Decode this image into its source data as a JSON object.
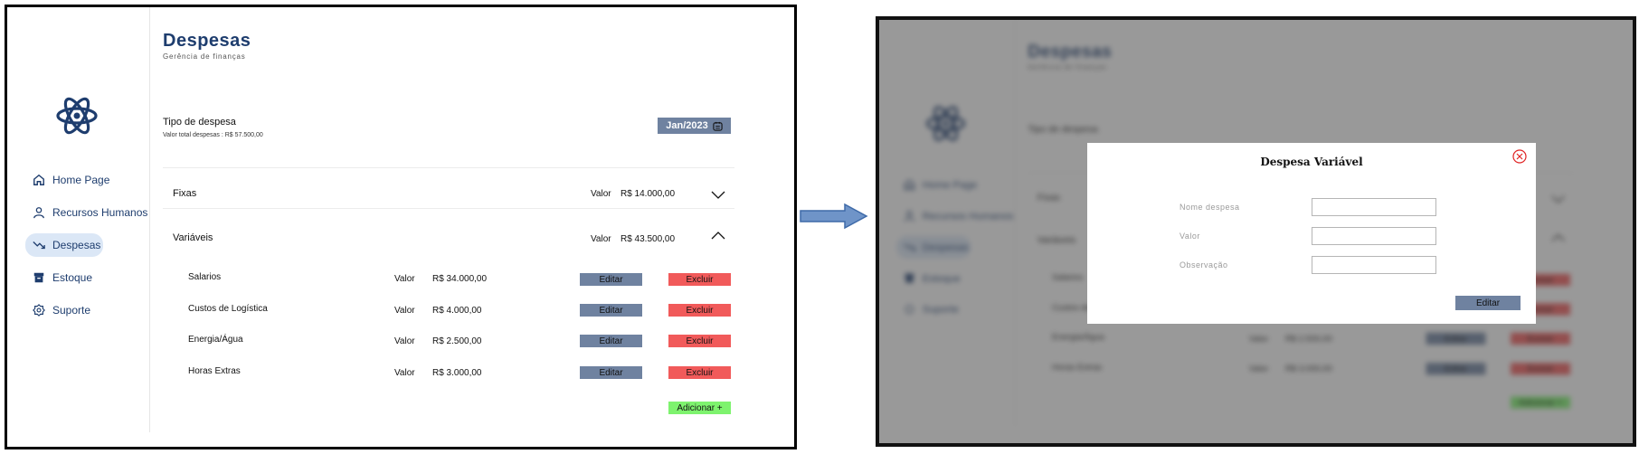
{
  "app": {
    "title": "Despesas",
    "subtitle": "Gerência de finanças",
    "nav": [
      {
        "label": "Home Page",
        "icon": "home-icon"
      },
      {
        "label": "Recursos Humanos",
        "icon": "user-icon"
      },
      {
        "label": "Despesas",
        "icon": "trend-down-icon",
        "active": true
      },
      {
        "label": "Estoque",
        "icon": "box-icon"
      },
      {
        "label": "Suporte",
        "icon": "support-icon"
      }
    ],
    "tipo_label": "Tipo de despesa",
    "tipo_total": "Valor total despesas : R$ 57.500,00",
    "month": "Jan/2023",
    "valor_label": "Valor",
    "groups": [
      {
        "label": "Fixas",
        "amount": "R$ 14.000,00",
        "expanded": false
      },
      {
        "label": "Variáveis",
        "amount": "R$ 43.500,00",
        "expanded": true
      }
    ],
    "items": [
      {
        "name": "Salarios",
        "amount": "R$ 34.000,00"
      },
      {
        "name": "Custos de Logística",
        "amount": "R$ 4.000,00"
      },
      {
        "name": "Energia/Água",
        "amount": "R$ 2.500,00"
      },
      {
        "name": "Horas Extras",
        "amount": "R$ 3.000,00"
      }
    ],
    "edit_label": "Editar",
    "delete_label": "Excluir",
    "add_label": "Adicionar +"
  },
  "modal": {
    "title": "Despesa Variável",
    "fields": [
      {
        "label": "Nome despesa",
        "value": ""
      },
      {
        "label": "Valor",
        "value": ""
      },
      {
        "label": "Observação",
        "value": ""
      }
    ],
    "submit_label": "Editar"
  },
  "colors": {
    "accent": "#1e3d6e",
    "edit_button": "#6f82a0",
    "delete_button": "#f15a5a",
    "add_button": "#7ef36e",
    "active_nav": "#dbe7f6",
    "close_icon": "#e02424"
  }
}
